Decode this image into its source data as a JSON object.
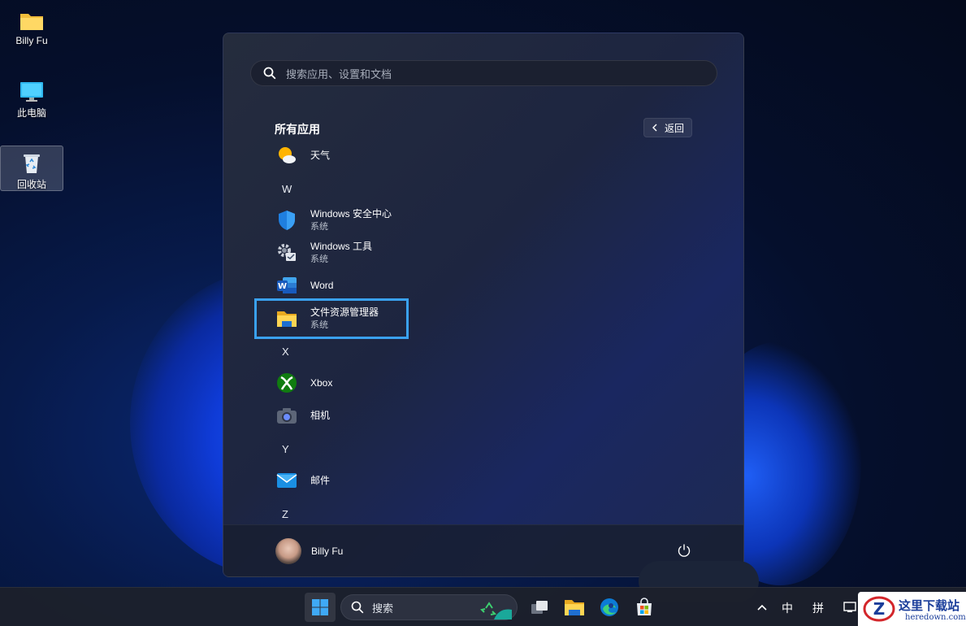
{
  "desktop": {
    "icons": [
      {
        "label": "Billy Fu",
        "icon": "folder-icon"
      },
      {
        "label": "此电脑",
        "icon": "monitor-icon"
      },
      {
        "label": "回收站",
        "icon": "recycle-bin-icon"
      }
    ]
  },
  "start_menu": {
    "search_placeholder": "搜索应用、设置和文档",
    "section_title": "所有应用",
    "back_label": "返回",
    "apps": [
      {
        "name": "天气",
        "sub": "",
        "icon": "weather-icon"
      },
      {
        "name": "Windows 安全中心",
        "sub": "系统",
        "icon": "shield-icon"
      },
      {
        "name": "Windows 工具",
        "sub": "系统",
        "icon": "tools-gear-icon"
      },
      {
        "name": "Word",
        "sub": "",
        "icon": "word-icon"
      },
      {
        "name": "文件资源管理器",
        "sub": "系统",
        "icon": "file-explorer-icon",
        "highlighted": true
      },
      {
        "name": "Xbox",
        "sub": "",
        "icon": "xbox-icon"
      },
      {
        "name": "相机",
        "sub": "",
        "icon": "camera-icon"
      },
      {
        "name": "邮件",
        "sub": "",
        "icon": "mail-icon"
      }
    ],
    "letters": [
      "W",
      "X",
      "Y",
      "Z"
    ],
    "user": "Billy Fu"
  },
  "taskbar": {
    "search_label": "搜索",
    "ime_lang": "中",
    "ime_mode": "拼"
  },
  "watermark": {
    "title": "这里下载站",
    "url": "heredown.com"
  },
  "colors": {
    "accent_highlight": "#3aa1f0",
    "start_bg": "#1d2540",
    "taskbar_bg": "#1c202c"
  }
}
